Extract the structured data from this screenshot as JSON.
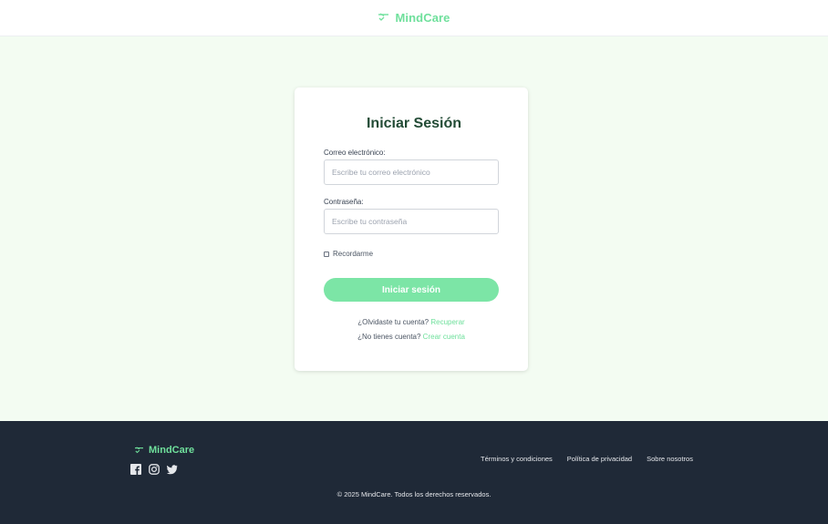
{
  "header": {
    "brand": "MindCare",
    "logo_icon": "heart-pulse-logo-icon"
  },
  "login": {
    "title": "Iniciar Sesión",
    "email": {
      "label": "Correo electrónico:",
      "placeholder": "Escribe tu correo electrónico",
      "value": ""
    },
    "password": {
      "label": "Contraseña:",
      "placeholder": "Escribe tu contraseña",
      "value": ""
    },
    "remember": {
      "label": "Recordarme",
      "checked": false
    },
    "submit_label": "Iniciar sesión",
    "forgot_text": "¿Olvidaste tu cuenta?",
    "forgot_link": "Recuperar",
    "signup_text": "¿No tienes cuenta?",
    "signup_link": "Crear cuenta"
  },
  "footer": {
    "brand": "MindCare",
    "socials": [
      "facebook-icon",
      "instagram-icon",
      "twitter-icon"
    ],
    "links": [
      "Términos y condiciones",
      "Política de privacidad",
      "Sobre nosotros"
    ],
    "copyright": "© 2025 MindCare. Todos los derechos reservados."
  },
  "colors": {
    "accent": "#6fe09c",
    "button": "#7ce5a6",
    "title": "#224b35",
    "footer_bg": "#1f2937",
    "page_bg": "#f3fcf2"
  }
}
